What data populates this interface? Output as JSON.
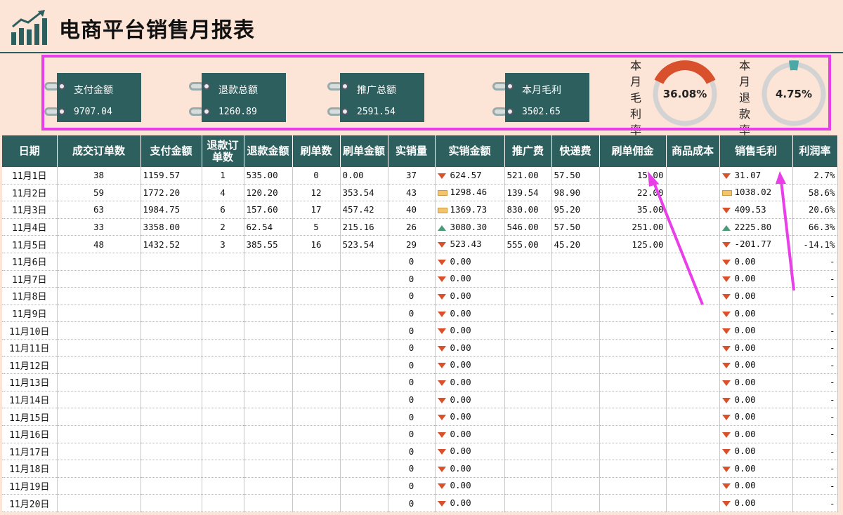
{
  "title": "电商平台销售月报表",
  "colors": {
    "accent": "#2e5f5f",
    "orange": "#d9512c",
    "teal": "#4aa9a7",
    "highlight": "#e83fe8"
  },
  "kpis": [
    {
      "label": "支付金额",
      "value": "9707.04"
    },
    {
      "label": "退款总额",
      "value": "1260.89"
    },
    {
      "label": "推广总额",
      "value": "2591.54"
    },
    {
      "label": "本月毛利",
      "value": "3502.65"
    }
  ],
  "gauges": [
    {
      "label_chars": [
        "本",
        "月",
        "毛",
        "利",
        "率"
      ],
      "value": "36.08%",
      "fraction": 0.3608,
      "color": "#d9512c"
    },
    {
      "label_chars": [
        "本",
        "月",
        "退",
        "款",
        "率"
      ],
      "value": "4.75%",
      "fraction": 0.0475,
      "color": "#4aa9a7"
    }
  ],
  "table": {
    "headers": [
      "日期",
      "成交订单数",
      "支付金额",
      "退款订\n单数",
      "退款金额",
      "刷单数",
      "刷单金额",
      "实销量",
      "实销金额",
      "推广费",
      "快递费",
      "刷单佣金",
      "商品成本",
      "销售毛利",
      "利润率"
    ],
    "rows": [
      [
        "11月1日",
        "38",
        "1159.57",
        "1",
        "535.00",
        "0",
        "0.00",
        "37",
        "624.57",
        "521.00",
        "57.50",
        "15.00",
        "",
        "31.07",
        "2.7%"
      ],
      [
        "11月2日",
        "59",
        "1772.20",
        "4",
        "120.20",
        "12",
        "353.54",
        "43",
        "1298.46",
        "139.54",
        "98.90",
        "22.00",
        "",
        "1038.02",
        "58.6%"
      ],
      [
        "11月3日",
        "63",
        "1984.75",
        "6",
        "157.60",
        "17",
        "457.42",
        "40",
        "1369.73",
        "830.00",
        "95.20",
        "35.00",
        "",
        "409.53",
        "20.6%"
      ],
      [
        "11月4日",
        "33",
        "3358.00",
        "2",
        "62.54",
        "5",
        "215.16",
        "26",
        "3080.30",
        "546.00",
        "57.50",
        "251.00",
        "",
        "2225.80",
        "66.3%"
      ],
      [
        "11月5日",
        "48",
        "1432.52",
        "3",
        "385.55",
        "16",
        "523.54",
        "29",
        "523.43",
        "555.00",
        "45.20",
        "125.00",
        "",
        "-201.77",
        "-14.1%"
      ],
      [
        "11月6日",
        "",
        "",
        "",
        "",
        "",
        "",
        "0",
        "0.00",
        "",
        "",
        "",
        "",
        "0.00",
        "-"
      ],
      [
        "11月7日",
        "",
        "",
        "",
        "",
        "",
        "",
        "0",
        "0.00",
        "",
        "",
        "",
        "",
        "0.00",
        "-"
      ],
      [
        "11月8日",
        "",
        "",
        "",
        "",
        "",
        "",
        "0",
        "0.00",
        "",
        "",
        "",
        "",
        "0.00",
        "-"
      ],
      [
        "11月9日",
        "",
        "",
        "",
        "",
        "",
        "",
        "0",
        "0.00",
        "",
        "",
        "",
        "",
        "0.00",
        "-"
      ],
      [
        "11月10日",
        "",
        "",
        "",
        "",
        "",
        "",
        "0",
        "0.00",
        "",
        "",
        "",
        "",
        "0.00",
        "-"
      ],
      [
        "11月11日",
        "",
        "",
        "",
        "",
        "",
        "",
        "0",
        "0.00",
        "",
        "",
        "",
        "",
        "0.00",
        "-"
      ],
      [
        "11月12日",
        "",
        "",
        "",
        "",
        "",
        "",
        "0",
        "0.00",
        "",
        "",
        "",
        "",
        "0.00",
        "-"
      ],
      [
        "11月13日",
        "",
        "",
        "",
        "",
        "",
        "",
        "0",
        "0.00",
        "",
        "",
        "",
        "",
        "0.00",
        "-"
      ],
      [
        "11月14日",
        "",
        "",
        "",
        "",
        "",
        "",
        "0",
        "0.00",
        "",
        "",
        "",
        "",
        "0.00",
        "-"
      ],
      [
        "11月15日",
        "",
        "",
        "",
        "",
        "",
        "",
        "0",
        "0.00",
        "",
        "",
        "",
        "",
        "0.00",
        "-"
      ],
      [
        "11月16日",
        "",
        "",
        "",
        "",
        "",
        "",
        "0",
        "0.00",
        "",
        "",
        "",
        "",
        "0.00",
        "-"
      ],
      [
        "11月17日",
        "",
        "",
        "",
        "",
        "",
        "",
        "0",
        "0.00",
        "",
        "",
        "",
        "",
        "0.00",
        "-"
      ],
      [
        "11月18日",
        "",
        "",
        "",
        "",
        "",
        "",
        "0",
        "0.00",
        "",
        "",
        "",
        "",
        "0.00",
        "-"
      ],
      [
        "11月19日",
        "",
        "",
        "",
        "",
        "",
        "",
        "0",
        "0.00",
        "",
        "",
        "",
        "",
        "0.00",
        "-"
      ],
      [
        "11月20日",
        "",
        "",
        "",
        "",
        "",
        "",
        "0",
        "0.00",
        "",
        "",
        "",
        "",
        "0.00",
        "-"
      ]
    ],
    "indicators": {
      "sales_amount": [
        "down",
        "flat",
        "flat",
        "up",
        "down",
        "down",
        "down",
        "down",
        "down",
        "down",
        "down",
        "down",
        "down",
        "down",
        "down",
        "down",
        "down",
        "down",
        "down",
        "down"
      ],
      "gross_profit": [
        "down",
        "flat",
        "down",
        "up",
        "down",
        "down",
        "down",
        "down",
        "down",
        "down",
        "down",
        "down",
        "down",
        "down",
        "down",
        "down",
        "down",
        "down",
        "down",
        "down"
      ]
    }
  }
}
